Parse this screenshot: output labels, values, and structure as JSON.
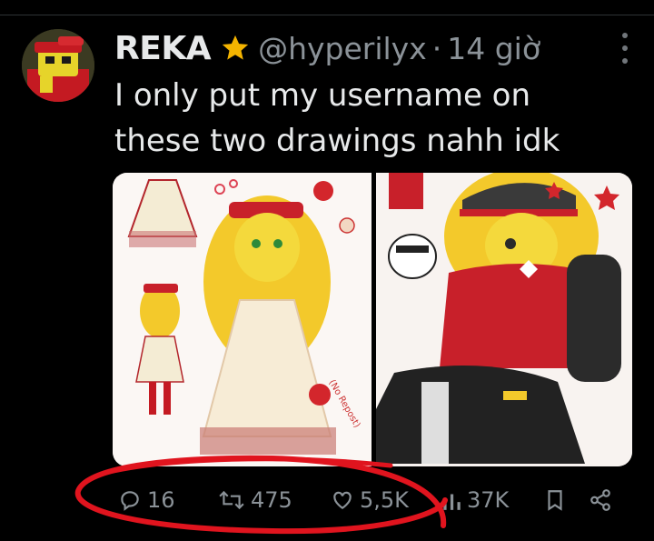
{
  "tweet": {
    "display_name": "REKA",
    "handle": "@hyperilyx",
    "separator": "·",
    "time": "14 giờ",
    "text_lines": [
      "I only put my username on",
      "these two drawings nahh idk"
    ]
  },
  "media": {
    "left_image": {
      "description_icon": "character-drawing-apple-dress",
      "accent_color": "#c8202a"
    },
    "right_image": {
      "description_icon": "character-drawing-cap-jacket",
      "accent_color": "#c8202a"
    }
  },
  "actions": {
    "replies": "16",
    "reposts": "475",
    "likes": "5,5K",
    "views": "37K"
  },
  "colors": {
    "background": "#000000",
    "text": "#e7e9ea",
    "muted": "#8b9298",
    "verified_star": "#f4b400",
    "annotation": "#e0141e"
  }
}
